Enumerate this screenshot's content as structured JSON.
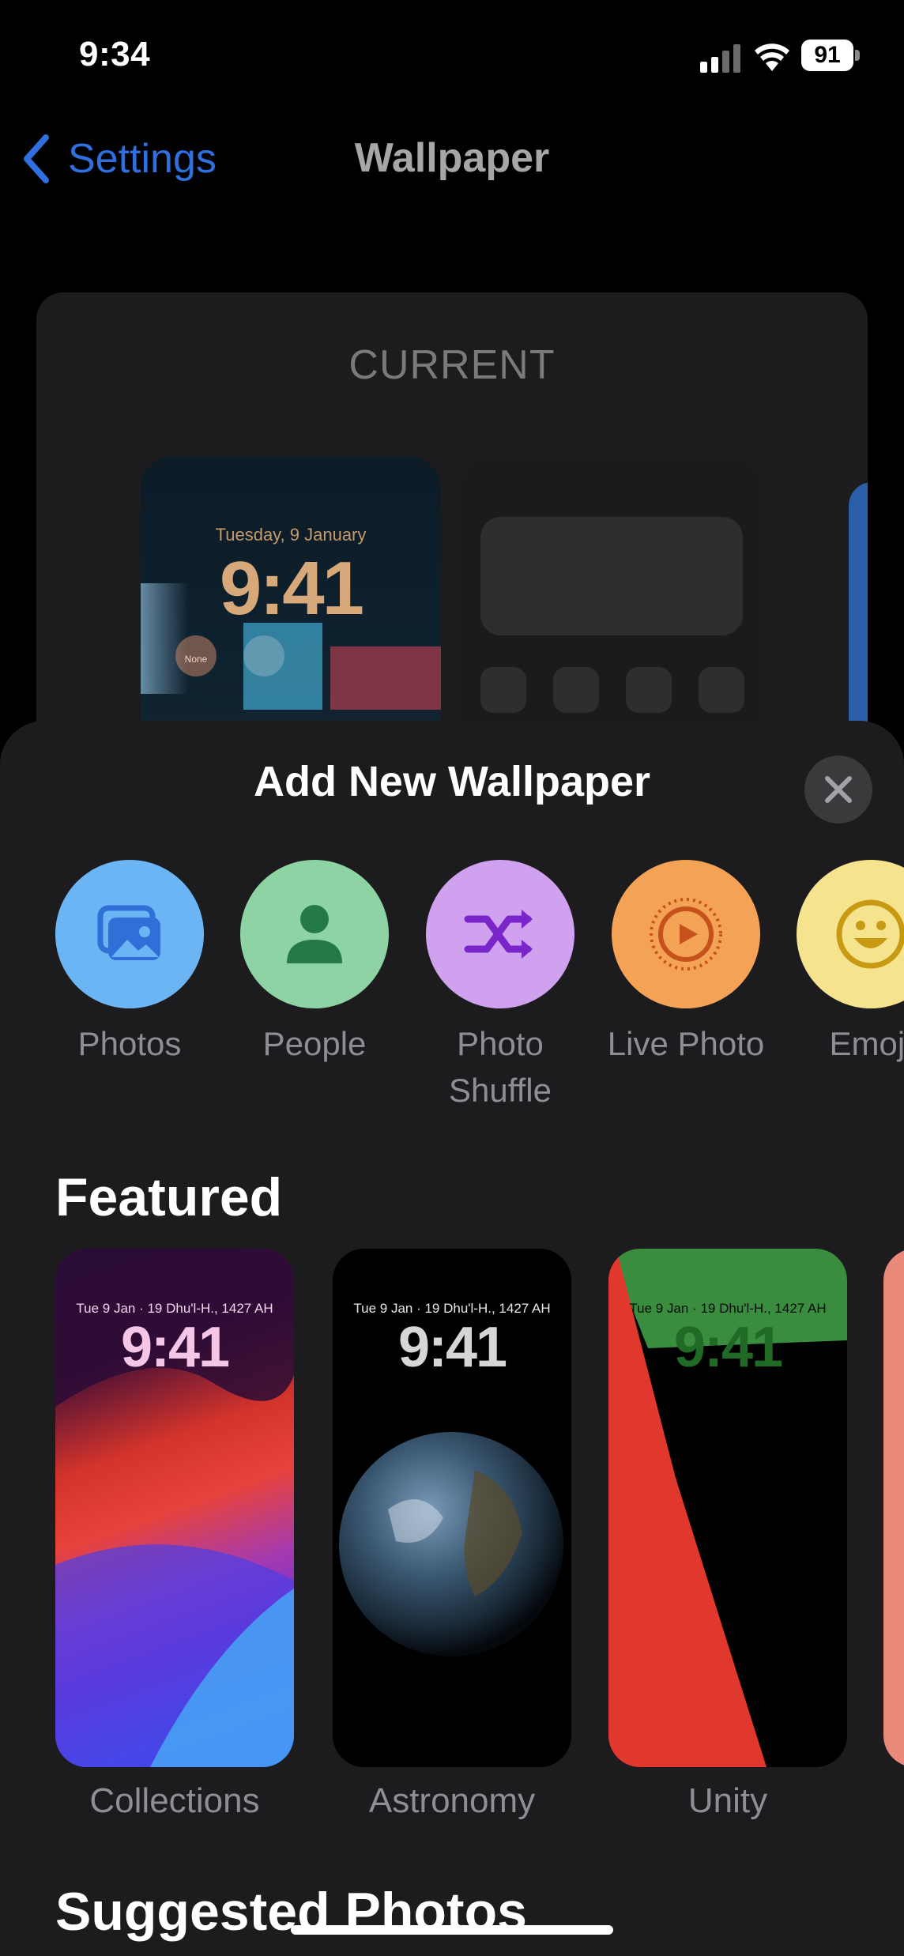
{
  "status_bar": {
    "time": "9:34",
    "battery": "91"
  },
  "nav": {
    "back_label": "Settings",
    "title": "Wallpaper"
  },
  "current": {
    "label": "CURRENT",
    "lock_date": "Tuesday, 9 January",
    "lock_time": "9:41",
    "lock_widget_label": "None"
  },
  "sheet": {
    "title": "Add New Wallpaper",
    "types": [
      {
        "label": "Photos",
        "icon": "photos-icon",
        "color": "#6cb5f5"
      },
      {
        "label": "People",
        "icon": "person-icon",
        "color": "#8ed3a4"
      },
      {
        "label": "Photo\nShuffle",
        "icon": "shuffle-icon",
        "color": "#cfa1ee"
      },
      {
        "label": "Live Photo",
        "icon": "live-photo-icon",
        "color": "#f4a256"
      },
      {
        "label": "Emoji",
        "icon": "emoji-icon",
        "color": "#f6e38e"
      }
    ],
    "featured_title": "Featured",
    "featured": [
      {
        "label": "Collections",
        "date": "Tue 9 Jan · 19 Dhu'l-H., 1427 AH",
        "time": "9:41"
      },
      {
        "label": "Astronomy",
        "date": "Tue 9 Jan · 19 Dhu'l-H., 1427 AH",
        "time": "9:41"
      },
      {
        "label": "Unity",
        "date": "Tue 9 Jan · 19 Dhu'l-H., 1427 AH",
        "time": "9:41"
      }
    ],
    "suggested_title": "Suggested Photos"
  },
  "colors": {
    "accent": "#2f6fe0",
    "sheet_bg": "#1c1c1e",
    "unity_green": "#3a8c3f",
    "unity_red": "#e0382c"
  }
}
